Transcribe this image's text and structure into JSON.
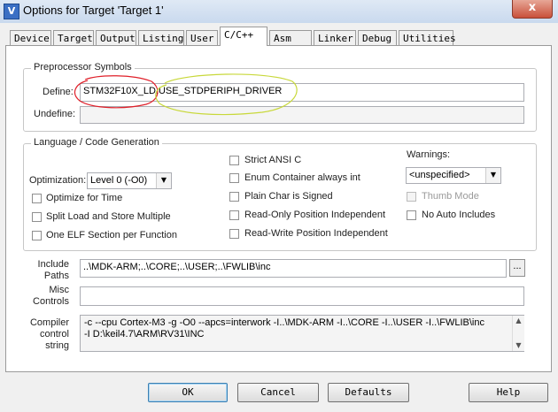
{
  "window": {
    "title": "Options for Target 'Target 1'",
    "close_glyph": "x",
    "app_icon_glyph": "V"
  },
  "tabs": [
    {
      "label": "Device"
    },
    {
      "label": "Target"
    },
    {
      "label": "Output"
    },
    {
      "label": "Listing"
    },
    {
      "label": "User"
    },
    {
      "label": "C/C++"
    },
    {
      "label": "Asm"
    },
    {
      "label": "Linker"
    },
    {
      "label": "Debug"
    },
    {
      "label": "Utilities"
    }
  ],
  "active_tab": "C/C++",
  "preprocessor": {
    "group_label": "Preprocessor Symbols",
    "define_label": "Define:",
    "define_value": "STM32F10X_LD,USE_STDPERIPH_DRIVER",
    "undefine_label": "Undefine:",
    "undefine_value": ""
  },
  "language": {
    "group_label": "Language / Code Generation",
    "optimization_label": "Optimization:",
    "optimization_value": "Level 0 (-O0)",
    "left_options": [
      {
        "label": "Optimize for Time",
        "checked": false
      },
      {
        "label": "Split Load and Store Multiple",
        "checked": false
      },
      {
        "label": "One ELF Section per Function",
        "checked": false
      }
    ],
    "middle_options": [
      {
        "label": "Strict ANSI C",
        "checked": false
      },
      {
        "label": "Enum Container always int",
        "checked": false
      },
      {
        "label": "Plain Char is Signed",
        "checked": false
      },
      {
        "label": "Read-Only Position Independent",
        "checked": false
      },
      {
        "label": "Read-Write Position Independent",
        "checked": false
      }
    ],
    "warnings_label": "Warnings:",
    "warnings_value": "<unspecified>",
    "right_options": [
      {
        "label": "Thumb Mode",
        "checked": false,
        "disabled": true
      },
      {
        "label": "No Auto Includes",
        "checked": false,
        "disabled": false
      }
    ]
  },
  "include_paths": {
    "label_line1": "Include",
    "label_line2": "Paths",
    "value": "..\\MDK-ARM;..\\CORE;..\\USER;..\\FWLIB\\inc",
    "browse": "..."
  },
  "misc_controls": {
    "label_line1": "Misc",
    "label_line2": "Controls",
    "value": ""
  },
  "compiler_control": {
    "label_line1": "Compiler",
    "label_line2": "control",
    "label_line3": "string",
    "line1": "-c --cpu Cortex-M3 -g -O0 --apcs=interwork -I..\\MDK-ARM -I..\\CORE -I..\\USER -I..\\FWLIB\\inc",
    "line2": "-I D:\\keil4.7\\ARM\\RV31\\INC"
  },
  "buttons": {
    "ok": "OK",
    "cancel": "Cancel",
    "defaults": "Defaults",
    "help": "Help"
  },
  "annotations": {
    "red_circle_color": "#e0202a",
    "yellow_circle_color": "#c8d83a"
  }
}
